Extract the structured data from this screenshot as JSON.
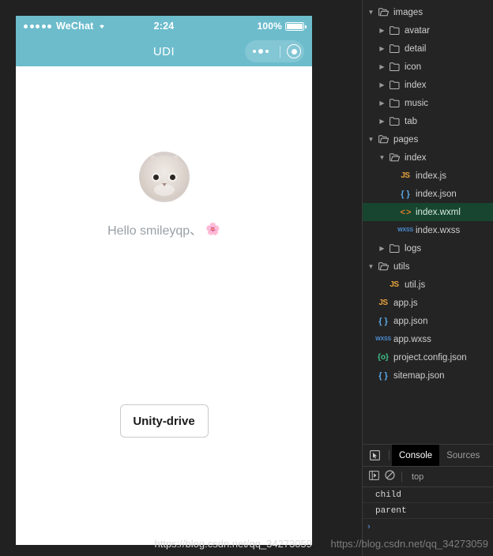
{
  "simulator": {
    "status_bar": {
      "carrier": "WeChat",
      "signal_dots": 5,
      "wifi_icon": "wifi-icon",
      "time": "2:24",
      "battery_percent": "100%",
      "battery_icon": "battery-icon"
    },
    "nav_bar": {
      "title": "UDI",
      "capsule": {
        "menu_icon": "ellipsis-icon",
        "close_icon": "target-icon"
      }
    },
    "page": {
      "avatar": "cat-avatar",
      "greeting": "Hello smileyqp、",
      "greeting_emoji": "🌸",
      "button_label": "Unity-drive"
    }
  },
  "devtools": {
    "file_tree": [
      {
        "label": "images",
        "depth": 0,
        "type": "folder-open",
        "twisty": "▾",
        "selected": false
      },
      {
        "label": "avatar",
        "depth": 1,
        "type": "folder",
        "twisty": "▸",
        "selected": false
      },
      {
        "label": "detail",
        "depth": 1,
        "type": "folder",
        "twisty": "▸",
        "selected": false
      },
      {
        "label": "icon",
        "depth": 1,
        "type": "folder",
        "twisty": "▸",
        "selected": false
      },
      {
        "label": "index",
        "depth": 1,
        "type": "folder",
        "twisty": "▸",
        "selected": false
      },
      {
        "label": "music",
        "depth": 1,
        "type": "folder",
        "twisty": "▸",
        "selected": false
      },
      {
        "label": "tab",
        "depth": 1,
        "type": "folder",
        "twisty": "▸",
        "selected": false
      },
      {
        "label": "pages",
        "depth": 0,
        "type": "folder-open",
        "twisty": "▾",
        "selected": false
      },
      {
        "label": "index",
        "depth": 1,
        "type": "folder-open",
        "twisty": "▾",
        "selected": false
      },
      {
        "label": "index.js",
        "depth": 2,
        "type": "js",
        "twisty": "",
        "selected": false
      },
      {
        "label": "index.json",
        "depth": 2,
        "type": "json",
        "twisty": "",
        "selected": false
      },
      {
        "label": "index.wxml",
        "depth": 2,
        "type": "wxml",
        "twisty": "",
        "selected": true
      },
      {
        "label": "index.wxss",
        "depth": 2,
        "type": "wxss",
        "twisty": "",
        "selected": false
      },
      {
        "label": "logs",
        "depth": 1,
        "type": "folder",
        "twisty": "▸",
        "selected": false
      },
      {
        "label": "utils",
        "depth": 0,
        "type": "folder-open",
        "twisty": "▾",
        "selected": false
      },
      {
        "label": "util.js",
        "depth": 1,
        "type": "js",
        "twisty": "",
        "selected": false
      },
      {
        "label": "app.js",
        "depth": 0,
        "type": "js",
        "twisty": "",
        "selected": false
      },
      {
        "label": "app.json",
        "depth": 0,
        "type": "json",
        "twisty": "",
        "selected": false
      },
      {
        "label": "app.wxss",
        "depth": 0,
        "type": "wxss",
        "twisty": "",
        "selected": false
      },
      {
        "label": "project.config.json",
        "depth": 0,
        "type": "config",
        "twisty": "",
        "selected": false
      },
      {
        "label": "sitemap.json",
        "depth": 0,
        "type": "json",
        "twisty": "",
        "selected": false
      }
    ],
    "console": {
      "inspect_icon": "inspect-element-icon",
      "tabs": [
        {
          "label": "Console",
          "active": true
        },
        {
          "label": "Sources",
          "active": false
        }
      ],
      "toolbar": {
        "sidebar_icon": "console-sidebar-icon",
        "clear_icon": "clear-console-icon",
        "context": "top"
      },
      "log_rows": [
        "child",
        "parent"
      ],
      "prompt": "›"
    }
  },
  "watermark": "https://blog.csdn.net/qq_34273059",
  "colors": {
    "accent_teal": "#6cbccc",
    "selected_row_green": "#17452f",
    "devtools_bg": "#242424",
    "js_icon": "#e8a33d",
    "json_icon": "#5aa9e6",
    "wxml_icon": "#e07b2a",
    "wxss_icon": "#4c8fd6",
    "config_icon": "#3ec48a"
  }
}
